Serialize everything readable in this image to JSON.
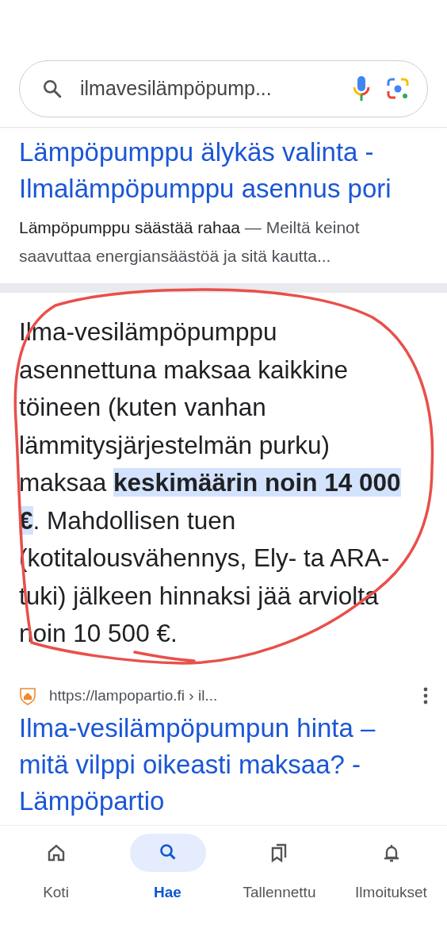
{
  "search": {
    "value": "ilmavesilämpöpump..."
  },
  "results": [
    {
      "kind": "ad",
      "title": "Lämpöpumppu älykäs valinta - Ilmalämpöpumppu asennus pori",
      "snippet_lead": "Lämpöpumppu säästää rahaa",
      "snippet_dash": "—",
      "snippet_rest": "Meiltä keinot saavuttaa energiansäästöä ja sitä kautta..."
    },
    {
      "kind": "featured",
      "text": "Ilma-vesilämpöpumppu asennettuna maksaa kaikkine töineen (kuten vanhan lämmitysjärjestelmän purku) maksaa **keskimäärin noin 14 000 €**. Mahdollisen tuen (kotitalousvähennys, Ely- ta ARA-tuki) jälkeen hinnaksi jää arviolta noin 10 500 €."
    },
    {
      "kind": "organic",
      "url": "https://lampopartio.fi › il...",
      "title": "Ilma-vesilämpöpumpun hinta – mitä vilppi oikeasti maksaa? - Lämpöpartio"
    }
  ],
  "nav": [
    {
      "label": "Koti",
      "selected": false
    },
    {
      "label": "Hae",
      "selected": true
    },
    {
      "label": "Tallennettu",
      "selected": false
    },
    {
      "label": "Ilmoitukset",
      "selected": false
    }
  ]
}
